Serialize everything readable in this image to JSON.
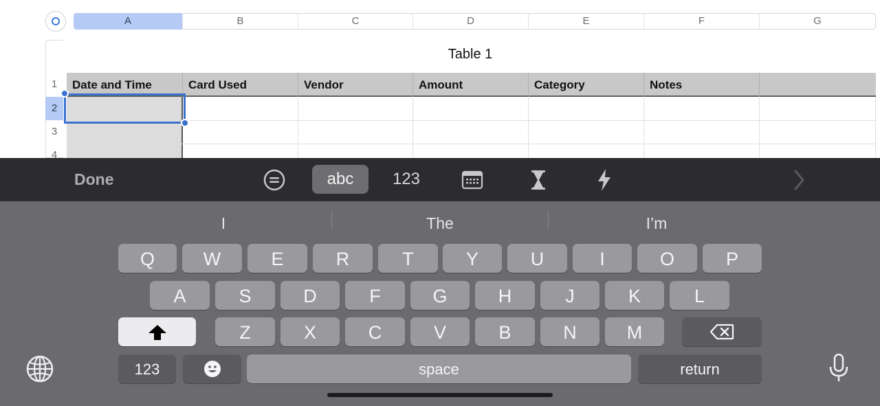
{
  "sheet": {
    "columns": [
      "A",
      "B",
      "C",
      "D",
      "E",
      "F",
      "G"
    ],
    "rows": [
      "1",
      "2",
      "3",
      "4"
    ],
    "table_title": "Table 1",
    "headers": [
      "Date and Time",
      "Card Used",
      "Vendor",
      "Amount",
      "Category",
      "Notes",
      ""
    ]
  },
  "toolbar": {
    "done_label": "Done",
    "abc_label": "abc",
    "numbers_label": "123",
    "icons": [
      "equals-circle-icon",
      "calendar-icon",
      "hourglass-icon",
      "lightning-icon",
      "chevron-right-icon"
    ]
  },
  "keyboard": {
    "suggestions": [
      "I",
      "The",
      "I’m"
    ],
    "row1": [
      "Q",
      "W",
      "E",
      "R",
      "T",
      "Y",
      "U",
      "I",
      "O",
      "P"
    ],
    "row2": [
      "A",
      "S",
      "D",
      "F",
      "G",
      "H",
      "J",
      "K",
      "L"
    ],
    "row3": [
      "Z",
      "X",
      "C",
      "V",
      "B",
      "N",
      "M"
    ],
    "numbers_key": "123",
    "space_label": "space",
    "return_label": "return"
  },
  "colors": {
    "selection": "#3a72d0",
    "column_highlight": "#b5cbf5",
    "keyboard_bg": "#6b6b6d",
    "toolbar_bg": "#2c2c2e"
  }
}
